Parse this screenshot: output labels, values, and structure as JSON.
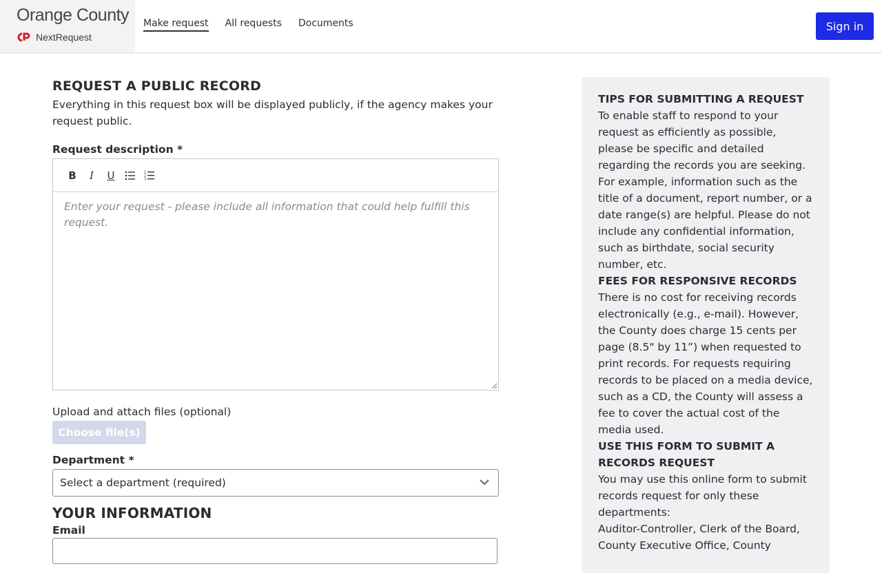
{
  "header": {
    "agency_name": "Orange County",
    "product_name": "NextRequest",
    "nav": [
      {
        "label": "Make request",
        "active": true
      },
      {
        "label": "All requests",
        "active": false
      },
      {
        "label": "Documents",
        "active": false
      }
    ],
    "sign_in_label": "Sign in",
    "accent_color": "#1d2ae6",
    "logo_color": "#d81e2a"
  },
  "form": {
    "title": "REQUEST A PUBLIC RECORD",
    "subtitle": "Everything in this request box will be displayed publicly, if the agency makes your request public.",
    "description_label": "Request description *",
    "toolbar": [
      {
        "icon": "bold-icon",
        "glyph": "B"
      },
      {
        "icon": "italic-icon",
        "glyph": "I"
      },
      {
        "icon": "underline-icon",
        "glyph": "U"
      },
      {
        "icon": "bullet-list-icon",
        "glyph": ""
      },
      {
        "icon": "numbered-list-icon",
        "glyph": ""
      }
    ],
    "description_placeholder": "Enter your request - please include all information that could help fulfill this request.",
    "upload_label": "Upload and attach files (optional)",
    "choose_files_label": "Choose file(s)",
    "department_label": "Department *",
    "department_value": "Select a department (required)",
    "your_info_title": "YOUR INFORMATION",
    "email_label": "Email"
  },
  "tips": {
    "heading1": "TIPS FOR SUBMITTING A REQUEST",
    "body1": "To enable staff to respond to your request as efficiently as possible, please be specific and detailed regarding the records you are seeking. For example, information such as the title of a document, report number, or a date range(s) are helpful. Please do not include any confidential information, such as birthdate, social security number, etc.",
    "heading2": "FEES FOR RESPONSIVE RECORDS",
    "body2": "There is no cost for receiving records electronically (e.g., e-mail). However, the County does charge 15 cents per page (8.5\" by 11”) when requested to print records. For requests requiring records to be placed on a media device, such as a CD, the County will assess a fee to cover the actual cost of the media used.",
    "heading3": "USE THIS FORM TO SUBMIT A RECORDS REQUEST",
    "body3": "You may use this online form to submit records request for only these departments:",
    "body4": "Auditor-Controller, Clerk of the Board, County Executive Office, County"
  }
}
